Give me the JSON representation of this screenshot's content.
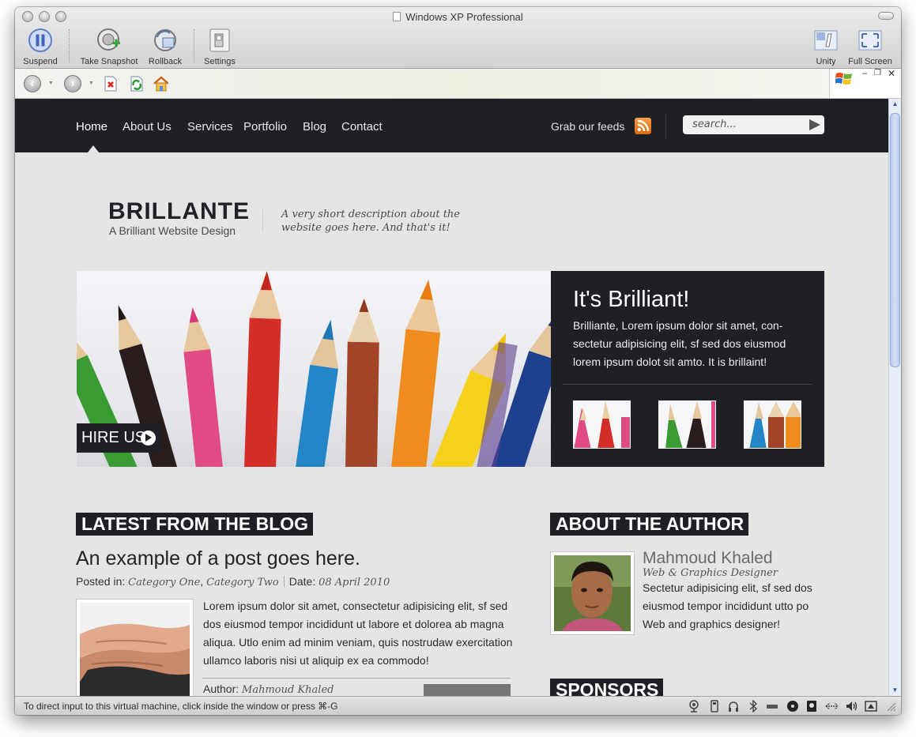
{
  "window": {
    "title": "Windows XP Professional",
    "toolbar": {
      "suspend": "Suspend",
      "take_snapshot": "Take Snapshot",
      "rollback": "Rollback",
      "settings": "Settings",
      "unity": "Unity",
      "full_screen": "Full Screen"
    }
  },
  "site": {
    "nav": [
      "Home",
      "About Us",
      "Services",
      "Portfolio",
      "Blog",
      "Contact"
    ],
    "feeds_label": "Grab our feeds",
    "search_placeholder": "search...",
    "logo": {
      "title": "BRILLANTE",
      "subtitle": "A Brilliant Website Design",
      "description": "A very short description about the website goes here. And that's it!"
    },
    "hero": {
      "hire_label": "HIRE US",
      "panel_title": "It's Brilliant!",
      "panel_text": "Brilliante, Lorem ipsum dolor sit amet, con-sectetur adipisicing elit, sf sed dos eiusmod lorem ipsum dolot sit amto. It is brillaint!"
    },
    "blog": {
      "heading": "LATEST FROM THE BLOG",
      "post_title": "An example of a post goes here.",
      "posted_in_label": "Posted in:",
      "category_one": "Category One",
      "category_two": "Category Two",
      "date_label": "Date:",
      "date": "08 April 2010",
      "excerpt": "Lorem ipsum dolor sit amet, consectetur adipisicing elit, sf sed dos eiusmod tempor incididunt ut labore et dolorea ab magna aliqua. Utlo enim ad minim veniam, quis nostrudaw exercitation ullamco laboris nisi ut aliquip ex ea commodo!",
      "author_label": "Author:",
      "author_name": "Mahmoud Khaled"
    },
    "about": {
      "heading": "ABOUT THE AUTHOR",
      "name": "Mahmoud Khaled",
      "role": "Web & Graphics Designer",
      "bio": "Sectetur adipisicing elit, sf sed dos eiusmod tempor incididunt utto po Web and graphics designer!"
    },
    "sponsors_heading": "SPONSORS"
  },
  "status_bar": {
    "message": "To direct input to this virtual machine, click inside the window or press ⌘-G"
  },
  "colors": {
    "site_dark": "#1f2026",
    "page_bg": "#e5e5e5",
    "rss_orange": "#e27419"
  }
}
